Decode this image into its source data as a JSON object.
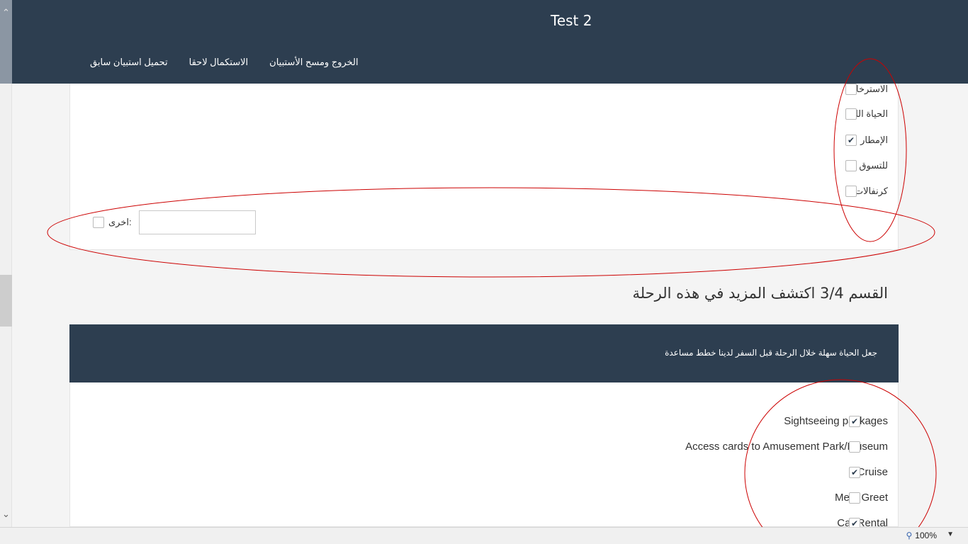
{
  "header": {
    "title": "Test 2",
    "nav": [
      "الخروج ومسح الأستبيان",
      "الاستكمال لاحقا",
      "تحميل استبيان سابق"
    ]
  },
  "section_prev": {
    "options": [
      {
        "label": "الاسترخاء",
        "checked": false
      },
      {
        "label": "الحياة الليلية",
        "checked": false
      },
      {
        "label": "الإمطار",
        "checked": true
      },
      {
        "label": "للتسوق",
        "checked": false
      },
      {
        "label": "كرنفالات",
        "checked": false
      }
    ],
    "other_label": "اخرى:",
    "other_value": ""
  },
  "section": {
    "title": "القسم 3/4 اكتشف المزيد في هذه الرحلة",
    "banner_text": "جعل الحياة سهلة خلال الرحلة قبل السفر لدينا خطط مساعدة",
    "options": [
      {
        "label": "Sightseeing packages",
        "checked": true
      },
      {
        "label": "Access cards to Amusement Park/Museum",
        "checked": false
      },
      {
        "label": "Cruise",
        "checked": true
      },
      {
        "label": "Meet Greet",
        "checked": false
      },
      {
        "label": "Car Rental",
        "checked": true
      }
    ]
  },
  "statusbar": {
    "zoom": "100%"
  },
  "icons": {
    "check": "✔",
    "zoom": "zoom-icon",
    "scroll_up": "chevron-up-icon",
    "scroll_down": "chevron-down-icon"
  },
  "colors": {
    "header_bg": "#2d3e50",
    "annotation": "#cc0000"
  }
}
